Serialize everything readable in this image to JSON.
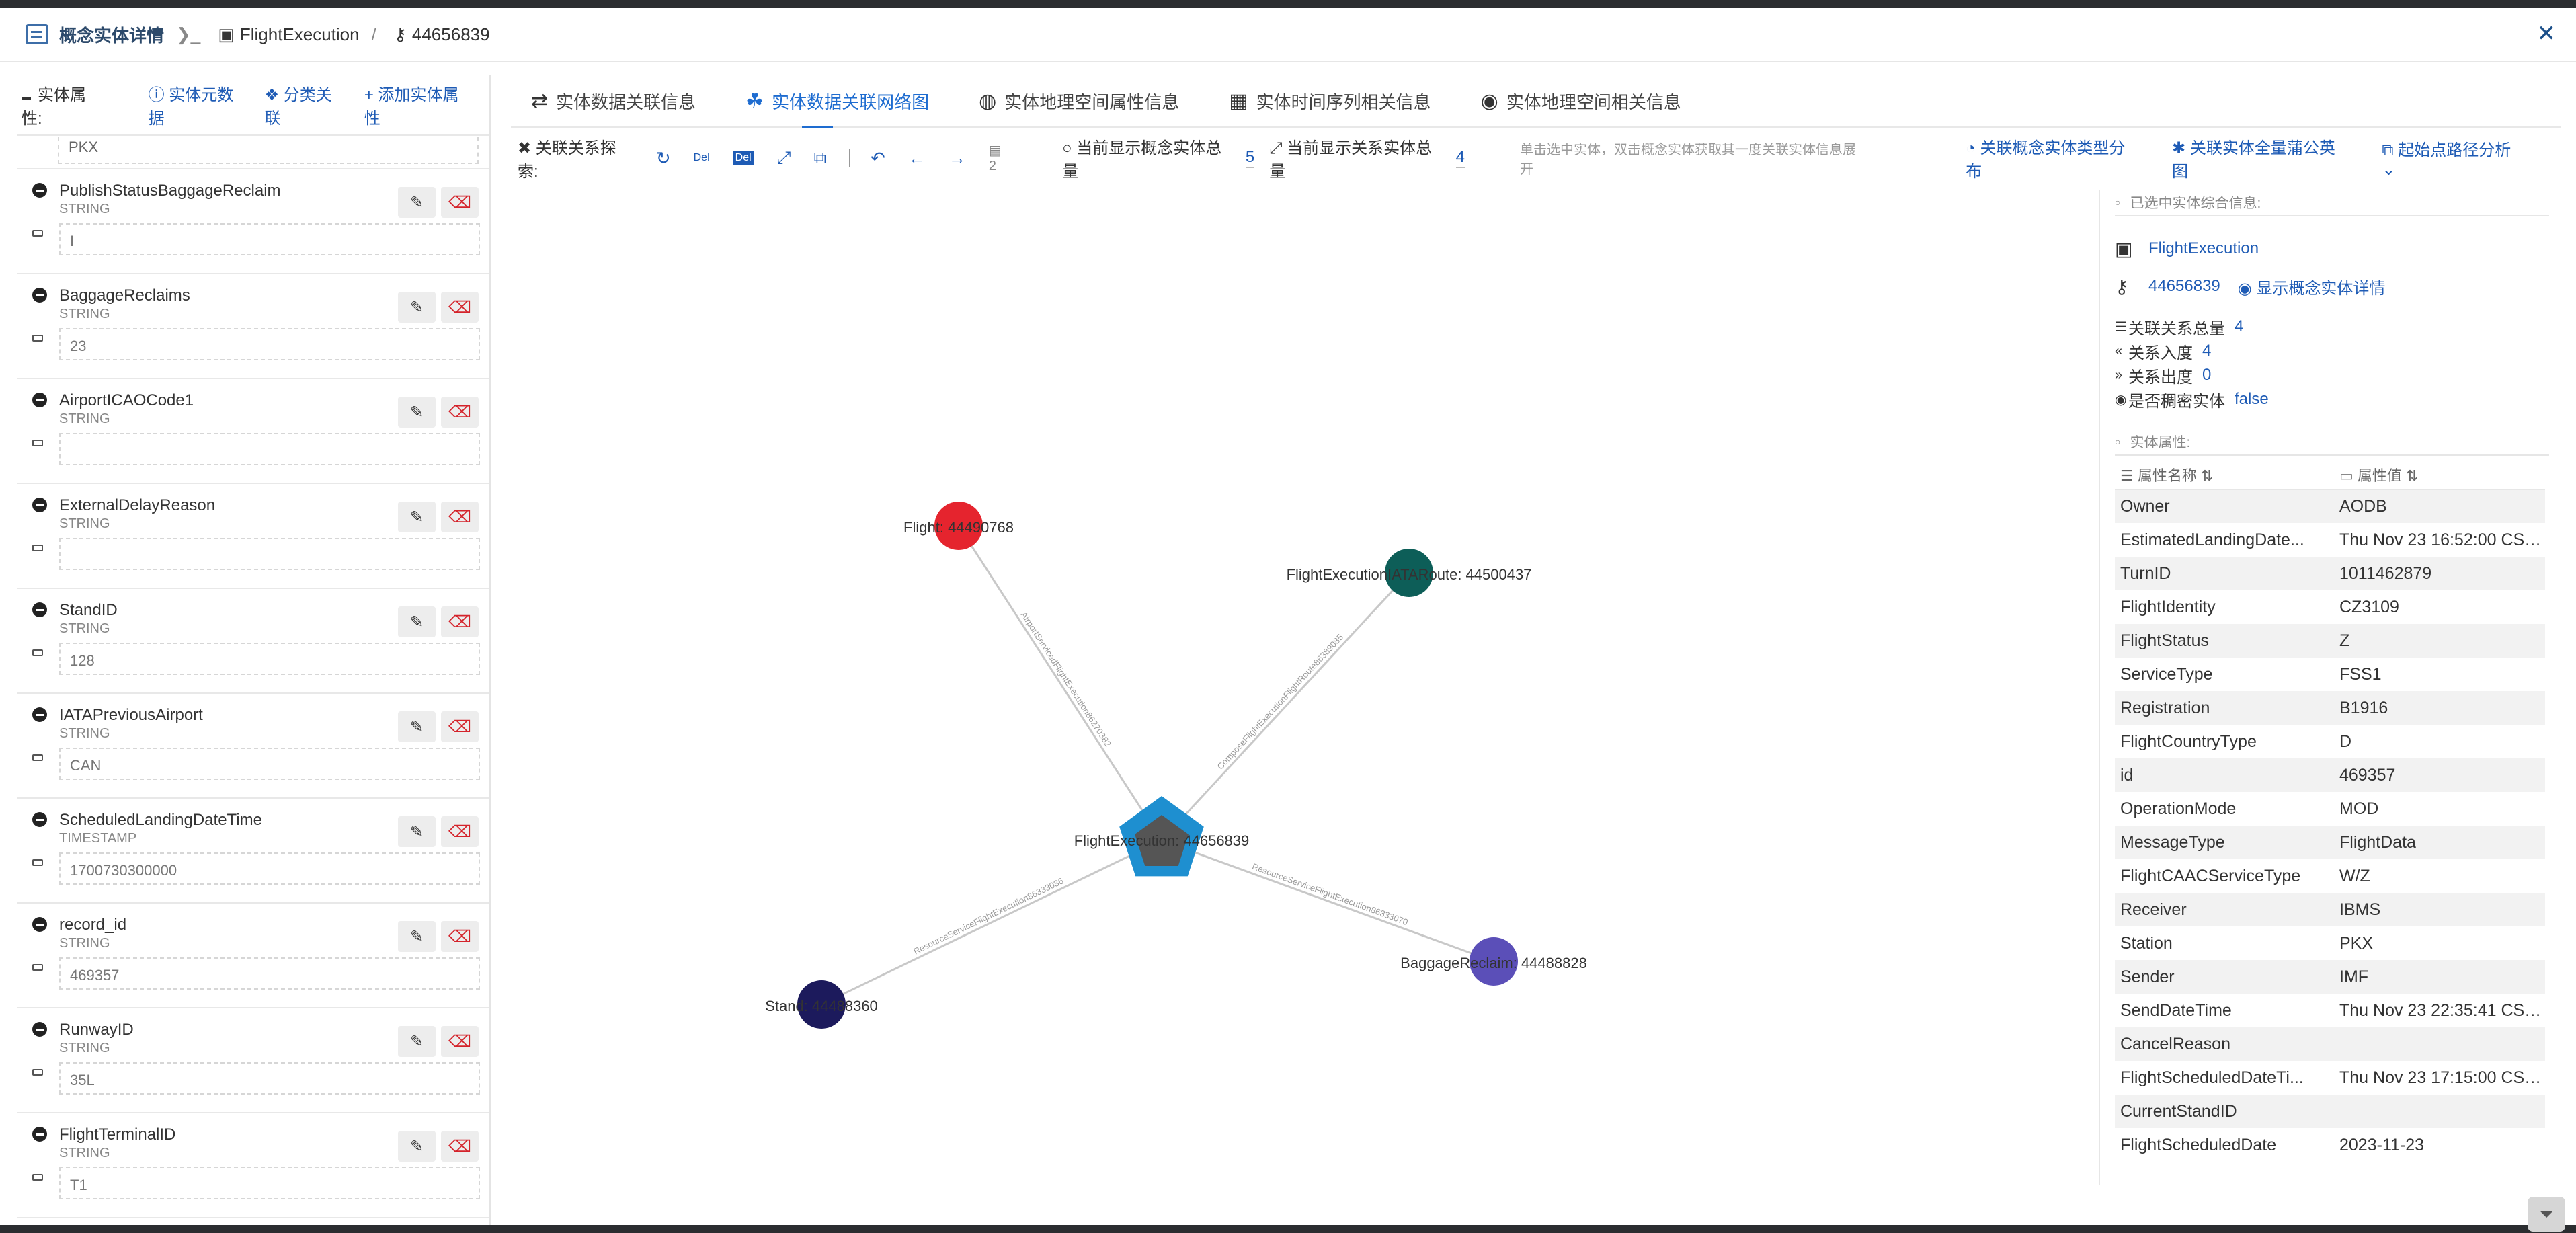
{
  "titlebar": {
    "title": "概念实体详情",
    "entity_type": "FlightExecution",
    "entity_id": "44656839"
  },
  "left": {
    "header": {
      "label": "实体属性:",
      "meta_link": "实体元数据",
      "classify_link": "分类关联",
      "add_link": "添加实体属性"
    },
    "top_value": "PKX",
    "attributes": [
      {
        "name": "PublishStatusBaggageReclaim",
        "type": "STRING",
        "value": "I"
      },
      {
        "name": "BaggageReclaims",
        "type": "STRING",
        "value": "23"
      },
      {
        "name": "AirportICAOCode1",
        "type": "STRING",
        "value": ""
      },
      {
        "name": "ExternalDelayReason",
        "type": "STRING",
        "value": ""
      },
      {
        "name": "StandID",
        "type": "STRING",
        "value": "128"
      },
      {
        "name": "IATAPreviousAirport",
        "type": "STRING",
        "value": "CAN"
      },
      {
        "name": "ScheduledLandingDateTime",
        "type": "TIMESTAMP",
        "value": "1700730300000"
      },
      {
        "name": "record_id",
        "type": "STRING",
        "value": "469357"
      },
      {
        "name": "RunwayID",
        "type": "STRING",
        "value": "35L"
      },
      {
        "name": "FlightTerminalID",
        "type": "STRING",
        "value": "T1"
      }
    ]
  },
  "tabs": [
    {
      "label": "实体数据关联信息",
      "icon": "relation-arrows-icon"
    },
    {
      "label": "实体数据关联网络图",
      "icon": "network-graph-icon",
      "active": true
    },
    {
      "label": "实体地理空间属性信息",
      "icon": "globe-icon"
    },
    {
      "label": "实体时间序列相关信息",
      "icon": "calendar-icon"
    },
    {
      "label": "实体地理空间相关信息",
      "icon": "map-pin-icon"
    }
  ],
  "toolbar": {
    "explore_label": "关联关系探索:",
    "del_label": "Del",
    "del2_label": "Del",
    "level_value": "2",
    "entity_count_label": "当前显示概念实体总量",
    "entity_count": "5",
    "relation_count_label": "当前显示关系实体总量",
    "relation_count": "4",
    "hint": "单击选中实体，双击概念实体获取其一度关联实体信息展开",
    "type_dist_link": "关联概念实体类型分布",
    "full_graph_link": "关联实体全量蒲公英图",
    "path_link": "起始点路径分析"
  },
  "graph": {
    "center": {
      "label": "FlightExecution: 44656839",
      "color": "#1e8fd0"
    },
    "nodes": [
      {
        "label": "Flight: 44490768",
        "color": "#e5242e"
      },
      {
        "label": "FlightExecutionIATARoute: 44500437",
        "color": "#0d5e58"
      },
      {
        "label": "BaggageReclaim: 44488828",
        "color": "#5b4fb8"
      },
      {
        "label": "Stand: 44488360",
        "color": "#1c1a5c"
      }
    ],
    "edges": [
      "AirportServicedFlightExecution86270382",
      "ComposeFlightExecutionFlightRoute86389085",
      "ResourceServiceFlightExecution86333070",
      "ResourceServiceFlightExecution86333036"
    ]
  },
  "info": {
    "selected_title": "已选中实体综合信息:",
    "entity_type": "FlightExecution",
    "entity_id": "44656839",
    "show_detail_link": "显示概念实体详情",
    "stats": [
      {
        "label": "关联关系总量",
        "value": "4",
        "icon": "list-icon"
      },
      {
        "label": "关系入度",
        "value": "4",
        "icon": "chevrons-left-icon"
      },
      {
        "label": "关系出度",
        "value": "0",
        "icon": "chevrons-right-icon"
      },
      {
        "label": "是否稠密实体",
        "value": "false",
        "icon": "dot-circle-icon"
      }
    ],
    "props_title": "实体属性:",
    "col_name": "属性名称",
    "col_value": "属性值",
    "props": [
      {
        "name": "Owner",
        "value": "AODB"
      },
      {
        "name": "EstimatedLandingDate...",
        "value": "Thu Nov 23 16:52:00 CST..."
      },
      {
        "name": "TurnID",
        "value": "1011462879"
      },
      {
        "name": "FlightIdentity",
        "value": "CZ3109"
      },
      {
        "name": "FlightStatus",
        "value": "Z"
      },
      {
        "name": "ServiceType",
        "value": "FSS1"
      },
      {
        "name": "Registration",
        "value": "B1916"
      },
      {
        "name": "FlightCountryType",
        "value": "D"
      },
      {
        "name": "id",
        "value": "469357"
      },
      {
        "name": "OperationMode",
        "value": "MOD"
      },
      {
        "name": "MessageType",
        "value": "FlightData"
      },
      {
        "name": "FlightCAACServiceType",
        "value": "W/Z"
      },
      {
        "name": "Receiver",
        "value": "IBMS"
      },
      {
        "name": "Station",
        "value": "PKX"
      },
      {
        "name": "Sender",
        "value": "IMF"
      },
      {
        "name": "SendDateTime",
        "value": "Thu Nov 23 22:35:41 CST..."
      },
      {
        "name": "CancelReason",
        "value": ""
      },
      {
        "name": "FlightScheduledDateTi...",
        "value": "Thu Nov 23 17:15:00 CST ..."
      },
      {
        "name": "CurrentStandID",
        "value": ""
      },
      {
        "name": "FlightScheduledDate",
        "value": "2023-11-23"
      }
    ]
  }
}
